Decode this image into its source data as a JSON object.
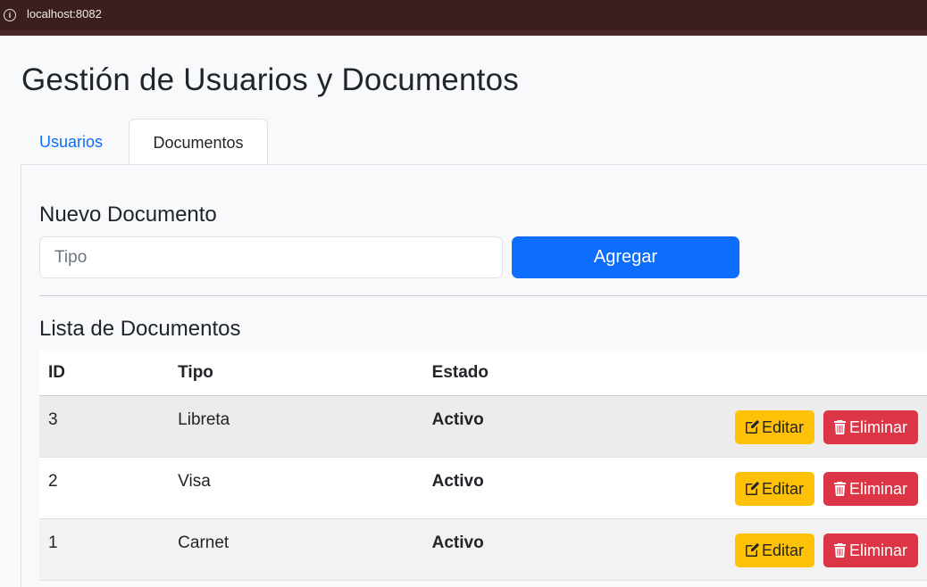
{
  "browser": {
    "url": "localhost:8082"
  },
  "page": {
    "title": "Gestión de Usuarios y Documentos"
  },
  "tabs": [
    {
      "label": "Usuarios",
      "active": false
    },
    {
      "label": "Documentos",
      "active": true
    }
  ],
  "form": {
    "title": "Nuevo Documento",
    "tipo_placeholder": "Tipo",
    "tipo_value": "",
    "submit_label": "Agregar"
  },
  "list": {
    "title": "Lista de Documentos",
    "headers": {
      "id": "ID",
      "tipo": "Tipo",
      "estado": "Estado",
      "acciones": ""
    },
    "rows": [
      {
        "id": "3",
        "tipo": "Libreta",
        "estado": "Activo",
        "edit_label": "Editar",
        "delete_label": "Eliminar"
      },
      {
        "id": "2",
        "tipo": "Visa",
        "estado": "Activo",
        "edit_label": "Editar",
        "delete_label": "Eliminar"
      },
      {
        "id": "1",
        "tipo": "Carnet",
        "estado": "Activo",
        "edit_label": "Editar",
        "delete_label": "Eliminar"
      }
    ]
  },
  "icons": {
    "edit": "pencil-square-icon",
    "delete": "trash-icon",
    "site_info": "info-circle-icon"
  },
  "colors": {
    "primary": "#0d6efd",
    "warning": "#ffc107",
    "danger": "#dc3545",
    "browser_bar": "#3b1f1f"
  }
}
